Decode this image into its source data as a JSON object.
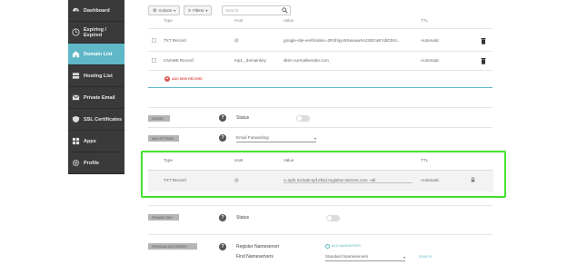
{
  "sidebar": {
    "items": [
      {
        "label": "Dashboard",
        "icon": "dashboard-icon"
      },
      {
        "label": "Expiring / Expired",
        "icon": "clock-icon"
      },
      {
        "label": "Domain List",
        "icon": "home-icon",
        "active": true
      },
      {
        "label": "Hosting List",
        "icon": "server-icon"
      },
      {
        "label": "Private Email",
        "icon": "envelope-icon"
      },
      {
        "label": "SSL Certificates",
        "icon": "shield-icon"
      },
      {
        "label": "Apps",
        "icon": "grid-icon"
      },
      {
        "label": "Profile",
        "icon": "gear-icon"
      }
    ]
  },
  "toolbar": {
    "actions_label": "Actions",
    "filters_label": "Filters",
    "search_placeholder": "Search"
  },
  "records_table": {
    "headers": [
      "Type",
      "Host",
      "Value",
      "TTL"
    ],
    "rows": [
      {
        "type": "TXT Record",
        "host": "@",
        "value": "google-site-verification=2R4hrjyo5Swaaw4AJ2BCwEYdiDDnt...",
        "ttl": "Automatic"
      },
      {
        "type": "CNAME Record",
        "host": "mp1._domainkey",
        "value": "dkim.ourmailsender.com",
        "ttl": "Automatic"
      }
    ],
    "add_record_label": "ADD NEW RECORD"
  },
  "dnssec": {
    "section_label": "DNSSEC",
    "status_label": "Status"
  },
  "mail_settings": {
    "section_label": "MAIL SETTINGS",
    "selected": "Email Forwarding"
  },
  "highlighted": {
    "headers": {
      "type": "Type",
      "host": "Host",
      "value": "Value",
      "ttl": "TTL"
    },
    "row": {
      "type": "TXT Record",
      "host": "@",
      "value": "v=spf1 include:spf.efwd.registrar-servers.com ~all",
      "ttl": "Automatic"
    }
  },
  "dynamic_dns": {
    "section_label": "DYNAMIC DNS",
    "status_label": "Status"
  },
  "personal_dns": {
    "section_label": "PERSONAL DNS SERVER",
    "register_label": "Register Nameserver",
    "add_label": "ADD NAMESERVER",
    "find_label": "Find Nameservers",
    "find_selected": "Standard Nameservers",
    "search_label": "SEARCH"
  },
  "colors": {
    "accent": "#5fb7c7",
    "highlight": "#42e42e",
    "sidebar": "#3a3a3a",
    "danger": "#d9534f"
  }
}
